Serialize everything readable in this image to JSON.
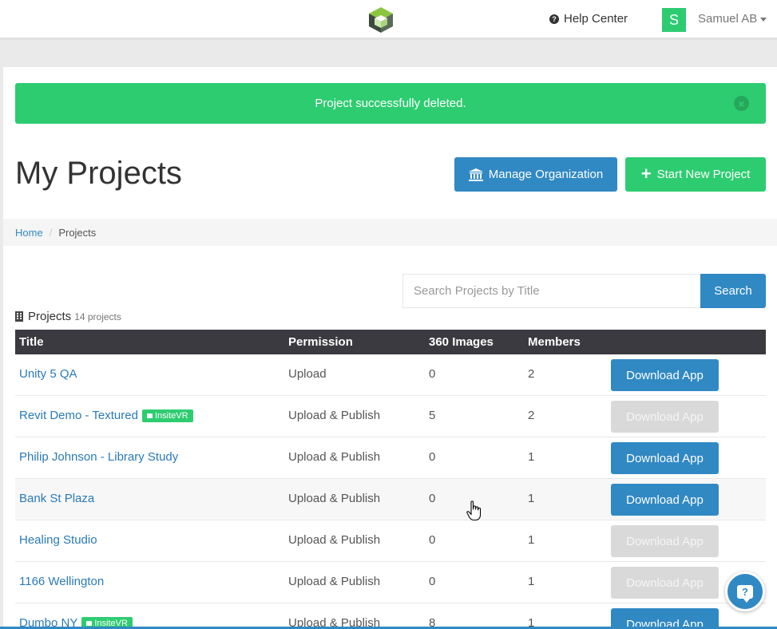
{
  "nav": {
    "help_label": "Help Center",
    "user_initial": "S",
    "user_name": "Samuel AB"
  },
  "alert": {
    "message": "Project successfully deleted.",
    "close_glyph": "×"
  },
  "page": {
    "title": "My Projects",
    "manage_org_label": "Manage Organization",
    "start_project_label": "Start New Project"
  },
  "breadcrumb": {
    "home": "Home",
    "separator": "/",
    "current": "Projects"
  },
  "search": {
    "placeholder": "Search Projects by Title",
    "button_label": "Search"
  },
  "projects": {
    "heading": "Projects",
    "count_label": "14 projects",
    "columns": [
      "Title",
      "Permission",
      "360 Images",
      "Members"
    ],
    "rows": [
      {
        "title": "Unity 5 QA",
        "tag": "",
        "permission": "Upload",
        "images": "0",
        "members": "2",
        "download": "Download App",
        "enabled": true
      },
      {
        "title": "Revit Demo - Textured",
        "tag": "InsiteVR",
        "permission": "Upload & Publish",
        "images": "5",
        "members": "2",
        "download": "Download App",
        "enabled": false
      },
      {
        "title": "Philip Johnson - Library Study",
        "tag": "",
        "permission": "Upload & Publish",
        "images": "0",
        "members": "1",
        "download": "Download App",
        "enabled": true
      },
      {
        "title": "Bank St Plaza",
        "tag": "",
        "permission": "Upload & Publish",
        "images": "0",
        "members": "1",
        "download": "Download App",
        "enabled": true
      },
      {
        "title": "Healing Studio",
        "tag": "",
        "permission": "Upload & Publish",
        "images": "0",
        "members": "1",
        "download": "Download App",
        "enabled": false
      },
      {
        "title": "1166 Wellington",
        "tag": "",
        "permission": "Upload & Publish",
        "images": "0",
        "members": "1",
        "download": "Download App",
        "enabled": false
      },
      {
        "title": "Dumbo NY",
        "tag": "InsiteVR",
        "permission": "Upload & Publish",
        "images": "8",
        "members": "1",
        "download": "Download App",
        "enabled": true
      }
    ]
  },
  "colors": {
    "primary": "#3189c4",
    "success": "#2ecc71",
    "header_dark": "#3a3a40",
    "disabled": "#d9d9d9"
  },
  "icons": [
    "logo-cube-icon",
    "help-circle-icon",
    "caret-down-icon",
    "close-circle-icon",
    "bank-icon",
    "plus-icon",
    "building-icon",
    "unlock-icon",
    "chat-help-icon",
    "hand-cursor-icon"
  ]
}
